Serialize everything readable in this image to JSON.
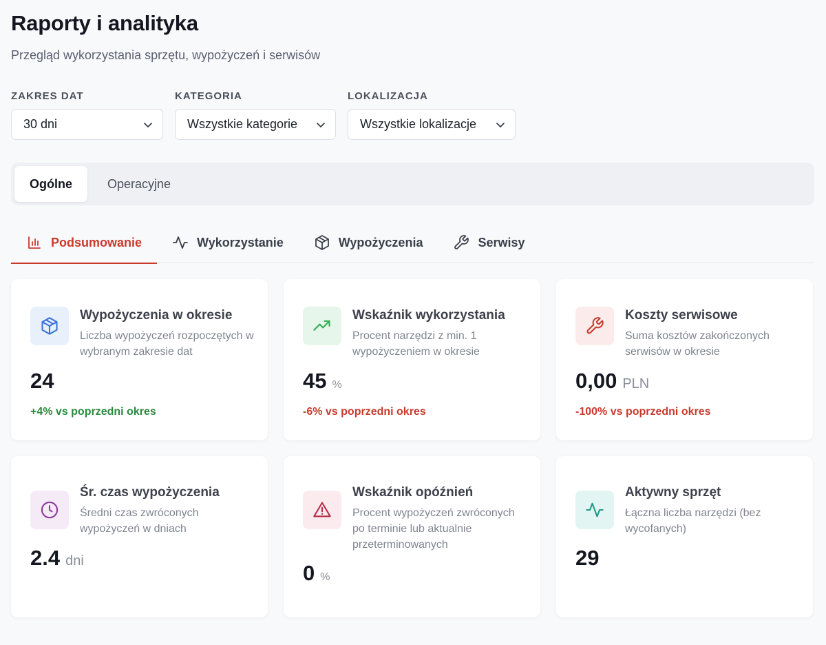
{
  "header": {
    "title": "Raporty i analityka",
    "subtitle": "Przegląd wykorzystania sprzętu, wypożyczeń i serwisów"
  },
  "filters": [
    {
      "label": "ZAKRES DAT",
      "value": "30 dni"
    },
    {
      "label": "KATEGORIA",
      "value": "Wszystkie kategorie"
    },
    {
      "label": "LOKALIZACJA",
      "value": "Wszystkie lokalizacje"
    }
  ],
  "segments": [
    {
      "label": "Ogólne",
      "active": true
    },
    {
      "label": "Operacyjne",
      "active": false
    }
  ],
  "tabs": [
    {
      "label": "Podsumowanie",
      "icon": "bar-chart-icon",
      "active": true
    },
    {
      "label": "Wykorzystanie",
      "icon": "activity-icon",
      "active": false
    },
    {
      "label": "Wypożyczenia",
      "icon": "box-icon",
      "active": false
    },
    {
      "label": "Serwisy",
      "icon": "wrench-icon",
      "active": false
    }
  ],
  "cards": [
    {
      "title": "Wypożyczenia w okresie",
      "description": "Liczba wypożyczeń rozpoczętych w wybranym zakresie dat",
      "value": "24",
      "unit": "",
      "delta": "+4% vs poprzedni okres",
      "icon": "box-icon",
      "icon_color": "#3b74d9",
      "icon_bg": "#e8f0fc"
    },
    {
      "title": "Wskaźnik wykorzystania",
      "description": "Procent narzędzi z min. 1 wypożyczeniem w okresie",
      "value": "45",
      "unit": "%",
      "delta": "-6% vs poprzedni okres",
      "icon": "trending-up-icon",
      "icon_color": "#2fae55",
      "icon_bg": "#e6f6eb"
    },
    {
      "title": "Koszty serwisowe",
      "description": "Suma kosztów zakończonych serwisów w okresie",
      "value": "0,00",
      "unit": "PLN",
      "delta": "-100% vs poprzedni okres",
      "icon": "wrench-icon",
      "icon_color": "#c93a2b",
      "icon_bg": "#fbeceb"
    },
    {
      "title": "Śr. czas wypożyczenia",
      "description": "Średni czas zwróconych wypożyczeń w dniach",
      "value": "2.4",
      "unit": "dni",
      "delta": "",
      "icon": "clock-icon",
      "icon_color": "#8b3a9c",
      "icon_bg": "#f5ebf7"
    },
    {
      "title": "Wskaźnik opóźnień",
      "description": "Procent wypożyczeń zwróconych po terminie lub aktualnie przeterminowanych",
      "value": "0",
      "unit": "%",
      "delta": "",
      "icon": "alert-triangle-icon",
      "icon_color": "#b53049",
      "icon_bg": "#fbebee"
    },
    {
      "title": "Aktywny sprzęt",
      "description": "Łączna liczba narzędzi (bez wycofanych)",
      "value": "29",
      "unit": "",
      "delta": "",
      "icon": "activity-icon",
      "icon_color": "#1f9a8a",
      "icon_bg": "#e3f5f2"
    }
  ]
}
